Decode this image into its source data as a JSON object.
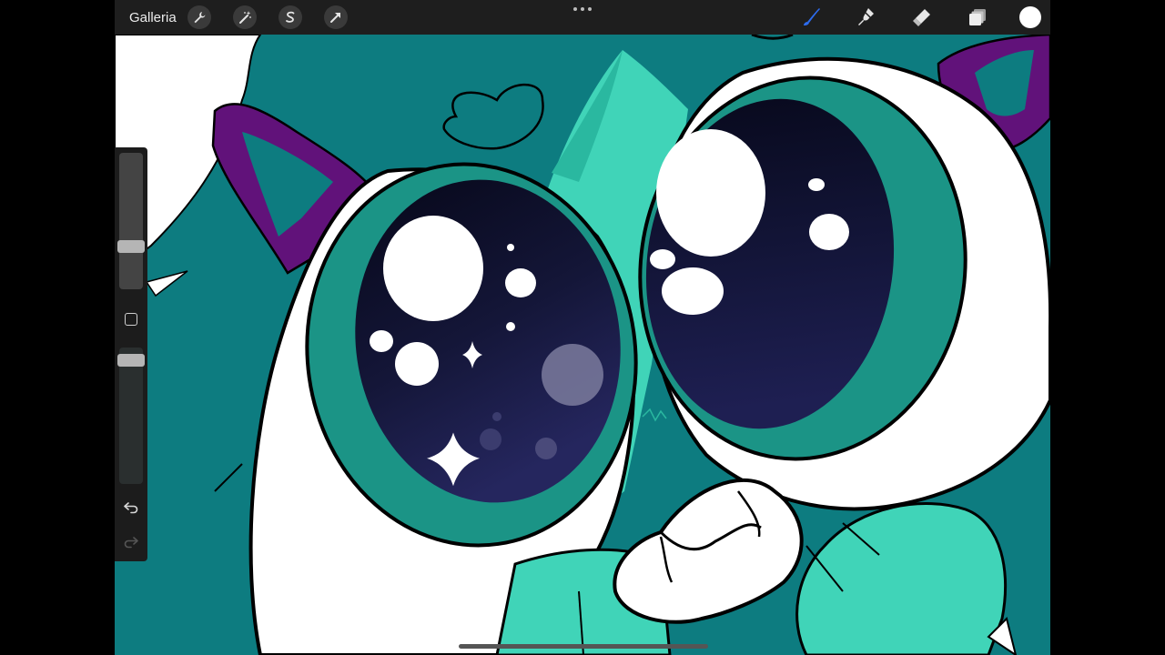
{
  "app": {
    "gallery_label": "Galleria",
    "accent_color": "#2d6cf0",
    "current_color": "#ffffff"
  },
  "toolbar_left": [
    {
      "name": "actions-wrench-icon"
    },
    {
      "name": "adjustments-magic-wand-icon"
    },
    {
      "name": "selection-s-icon"
    },
    {
      "name": "transform-arrow-icon"
    }
  ],
  "toolbar_right": [
    {
      "name": "brush-icon",
      "active": true
    },
    {
      "name": "smudge-icon",
      "active": false
    },
    {
      "name": "eraser-icon",
      "active": false
    },
    {
      "name": "layers-icon",
      "active": false
    },
    {
      "name": "color-swatch",
      "active": false
    }
  ],
  "sidebar": {
    "brush_size_level": 0.7,
    "opacity_level": 0.95
  },
  "artwork": {
    "palette": {
      "background_teal": "#0d7c80",
      "light_teal": "#40d4b8",
      "mid_teal": "#1b9486",
      "iris_dark": "#0c0a24",
      "iris_mid": "#1e1f52",
      "purple": "#61127a",
      "white": "#ffffff",
      "outline": "#000000"
    }
  }
}
